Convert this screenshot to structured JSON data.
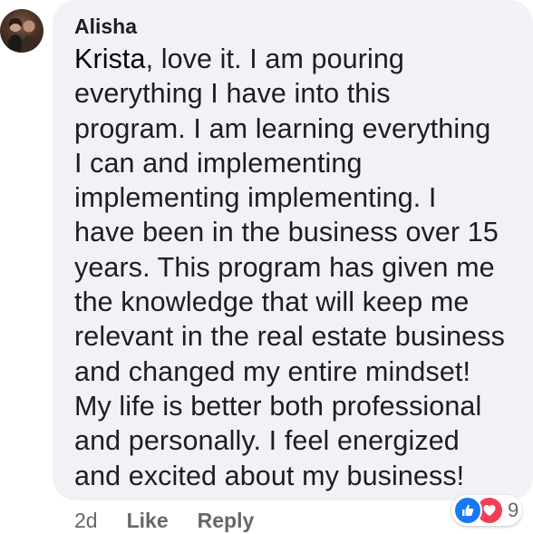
{
  "comment": {
    "author": "Alisha",
    "mention": "Krista",
    "body_lines": [
      "love it. I am pouring",
      "everything I have into this",
      "program. I am learning everything",
      "I can and implementing",
      "implementing implementing. I",
      "have been in the business over 15",
      "years. This program has given me",
      "the knowledge that will keep me",
      "relevant in the real estate business",
      "and changed my entire mindset!",
      "My life is better both professional",
      "and personally. I feel energized",
      "and excited about my business!"
    ],
    "timestamp": "2d",
    "like_label": "Like",
    "reply_label": "Reply",
    "reactions": {
      "icons": [
        "thumbs-up-icon",
        "heart-icon"
      ],
      "count": "9",
      "like_color": "#1877f2",
      "love_color": "#f33e58"
    }
  }
}
